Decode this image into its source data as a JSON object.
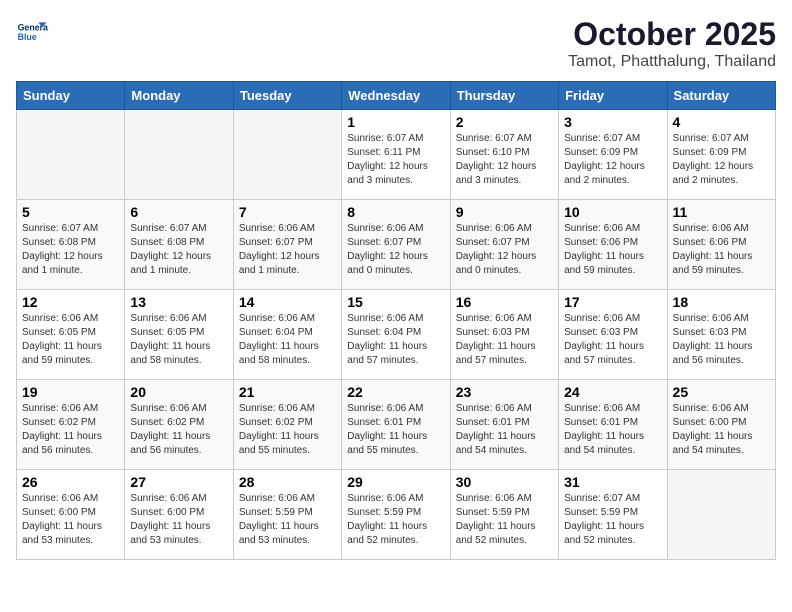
{
  "logo": {
    "line1": "General",
    "line2": "Blue"
  },
  "title": "October 2025",
  "subtitle": "Tamot, Phatthalung, Thailand",
  "headers": [
    "Sunday",
    "Monday",
    "Tuesday",
    "Wednesday",
    "Thursday",
    "Friday",
    "Saturday"
  ],
  "weeks": [
    [
      {
        "day": "",
        "text": ""
      },
      {
        "day": "",
        "text": ""
      },
      {
        "day": "",
        "text": ""
      },
      {
        "day": "1",
        "text": "Sunrise: 6:07 AM\nSunset: 6:11 PM\nDaylight: 12 hours and 3 minutes."
      },
      {
        "day": "2",
        "text": "Sunrise: 6:07 AM\nSunset: 6:10 PM\nDaylight: 12 hours and 3 minutes."
      },
      {
        "day": "3",
        "text": "Sunrise: 6:07 AM\nSunset: 6:09 PM\nDaylight: 12 hours and 2 minutes."
      },
      {
        "day": "4",
        "text": "Sunrise: 6:07 AM\nSunset: 6:09 PM\nDaylight: 12 hours and 2 minutes."
      }
    ],
    [
      {
        "day": "5",
        "text": "Sunrise: 6:07 AM\nSunset: 6:08 PM\nDaylight: 12 hours and 1 minute."
      },
      {
        "day": "6",
        "text": "Sunrise: 6:07 AM\nSunset: 6:08 PM\nDaylight: 12 hours and 1 minute."
      },
      {
        "day": "7",
        "text": "Sunrise: 6:06 AM\nSunset: 6:07 PM\nDaylight: 12 hours and 1 minute."
      },
      {
        "day": "8",
        "text": "Sunrise: 6:06 AM\nSunset: 6:07 PM\nDaylight: 12 hours and 0 minutes."
      },
      {
        "day": "9",
        "text": "Sunrise: 6:06 AM\nSunset: 6:07 PM\nDaylight: 12 hours and 0 minutes."
      },
      {
        "day": "10",
        "text": "Sunrise: 6:06 AM\nSunset: 6:06 PM\nDaylight: 11 hours and 59 minutes."
      },
      {
        "day": "11",
        "text": "Sunrise: 6:06 AM\nSunset: 6:06 PM\nDaylight: 11 hours and 59 minutes."
      }
    ],
    [
      {
        "day": "12",
        "text": "Sunrise: 6:06 AM\nSunset: 6:05 PM\nDaylight: 11 hours and 59 minutes."
      },
      {
        "day": "13",
        "text": "Sunrise: 6:06 AM\nSunset: 6:05 PM\nDaylight: 11 hours and 58 minutes."
      },
      {
        "day": "14",
        "text": "Sunrise: 6:06 AM\nSunset: 6:04 PM\nDaylight: 11 hours and 58 minutes."
      },
      {
        "day": "15",
        "text": "Sunrise: 6:06 AM\nSunset: 6:04 PM\nDaylight: 11 hours and 57 minutes."
      },
      {
        "day": "16",
        "text": "Sunrise: 6:06 AM\nSunset: 6:03 PM\nDaylight: 11 hours and 57 minutes."
      },
      {
        "day": "17",
        "text": "Sunrise: 6:06 AM\nSunset: 6:03 PM\nDaylight: 11 hours and 57 minutes."
      },
      {
        "day": "18",
        "text": "Sunrise: 6:06 AM\nSunset: 6:03 PM\nDaylight: 11 hours and 56 minutes."
      }
    ],
    [
      {
        "day": "19",
        "text": "Sunrise: 6:06 AM\nSunset: 6:02 PM\nDaylight: 11 hours and 56 minutes."
      },
      {
        "day": "20",
        "text": "Sunrise: 6:06 AM\nSunset: 6:02 PM\nDaylight: 11 hours and 56 minutes."
      },
      {
        "day": "21",
        "text": "Sunrise: 6:06 AM\nSunset: 6:02 PM\nDaylight: 11 hours and 55 minutes."
      },
      {
        "day": "22",
        "text": "Sunrise: 6:06 AM\nSunset: 6:01 PM\nDaylight: 11 hours and 55 minutes."
      },
      {
        "day": "23",
        "text": "Sunrise: 6:06 AM\nSunset: 6:01 PM\nDaylight: 11 hours and 54 minutes."
      },
      {
        "day": "24",
        "text": "Sunrise: 6:06 AM\nSunset: 6:01 PM\nDaylight: 11 hours and 54 minutes."
      },
      {
        "day": "25",
        "text": "Sunrise: 6:06 AM\nSunset: 6:00 PM\nDaylight: 11 hours and 54 minutes."
      }
    ],
    [
      {
        "day": "26",
        "text": "Sunrise: 6:06 AM\nSunset: 6:00 PM\nDaylight: 11 hours and 53 minutes."
      },
      {
        "day": "27",
        "text": "Sunrise: 6:06 AM\nSunset: 6:00 PM\nDaylight: 11 hours and 53 minutes."
      },
      {
        "day": "28",
        "text": "Sunrise: 6:06 AM\nSunset: 5:59 PM\nDaylight: 11 hours and 53 minutes."
      },
      {
        "day": "29",
        "text": "Sunrise: 6:06 AM\nSunset: 5:59 PM\nDaylight: 11 hours and 52 minutes."
      },
      {
        "day": "30",
        "text": "Sunrise: 6:06 AM\nSunset: 5:59 PM\nDaylight: 11 hours and 52 minutes."
      },
      {
        "day": "31",
        "text": "Sunrise: 6:07 AM\nSunset: 5:59 PM\nDaylight: 11 hours and 52 minutes."
      },
      {
        "day": "",
        "text": ""
      }
    ]
  ]
}
